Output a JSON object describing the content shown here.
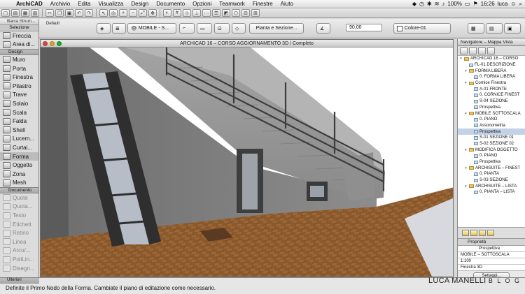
{
  "menubar": {
    "app": "ArchiCAD",
    "items": [
      "Archivio",
      "Edita",
      "Visualizza",
      "Design",
      "Documento",
      "Opzioni",
      "Teamwork",
      "Finestre",
      "Aiuto"
    ],
    "battery": "100%",
    "time": "16:26",
    "user": "luca"
  },
  "infobox": {
    "default_label": "Default",
    "layer": "MOBILE - S...",
    "view": "Pianta e Sezione...",
    "angle": "90,00",
    "color": "Colore-01"
  },
  "toolbox": {
    "header": "Barra Strum...",
    "selection": "Selezione",
    "select_tools": [
      {
        "icon": "arrow-icon",
        "label": "Freccia"
      },
      {
        "icon": "marquee-icon",
        "label": "Area di..."
      }
    ],
    "design_group": "Design",
    "design_tools": [
      {
        "icon": "wall-icon",
        "label": "Muro"
      },
      {
        "icon": "door-icon",
        "label": "Porta"
      },
      {
        "icon": "window-icon",
        "label": "Finestra"
      },
      {
        "icon": "column-icon",
        "label": "Pilastro"
      },
      {
        "icon": "beam-icon",
        "label": "Trave"
      },
      {
        "icon": "slab-icon",
        "label": "Solaio"
      },
      {
        "icon": "stair-icon",
        "label": "Scala"
      },
      {
        "icon": "roof-icon",
        "label": "Falda"
      },
      {
        "icon": "shell-icon",
        "label": "Shell"
      },
      {
        "icon": "skylight-icon",
        "label": "Lucern..."
      },
      {
        "icon": "curtain-wall-icon",
        "label": "Curtai..."
      },
      {
        "icon": "morph-icon",
        "label": "Forma"
      },
      {
        "icon": "object-icon",
        "label": "Oggetto"
      },
      {
        "icon": "zone-icon",
        "label": "Zona"
      },
      {
        "icon": "mesh-icon",
        "label": "Mesh"
      }
    ],
    "document_group": "Documento",
    "document_tools": [
      {
        "icon": "dimension-icon",
        "label": "Quote"
      },
      {
        "icon": "level-dimension-icon",
        "label": "Quota..."
      },
      {
        "icon": "text-icon",
        "label": "Testo"
      },
      {
        "icon": "label-icon",
        "label": "Etichett"
      },
      {
        "icon": "fill-icon",
        "label": "Retino"
      },
      {
        "icon": "line-icon",
        "label": "Linea"
      },
      {
        "icon": "arc-icon",
        "label": "Arco/..."
      },
      {
        "icon": "polyline-icon",
        "label": "PoliLin..."
      },
      {
        "icon": "drawing-icon",
        "label": "Disegn..."
      }
    ],
    "more_group": "Ulteriori"
  },
  "window": {
    "title": "ARCHICAD 16 – CORSO AGGIORNAMENTO 3D / Completo"
  },
  "navigator": {
    "header": "Navigatore – Mappa Vista",
    "tree": [
      {
        "level": 0,
        "type": "project",
        "label": "ARCHICAD 16 – CORSO",
        "selected": false
      },
      {
        "level": 1,
        "type": "plan",
        "label": "FL-01 DESCRIZIONE",
        "selected": false
      },
      {
        "level": 1,
        "type": "folder",
        "label": "FORMA LIBERA",
        "selected": false
      },
      {
        "level": 2,
        "type": "plan",
        "label": "0. FORMA LIBERA",
        "selected": false
      },
      {
        "level": 1,
        "type": "folder",
        "label": "Cornice Finestra",
        "selected": false
      },
      {
        "level": 2,
        "type": "plan",
        "label": "A-01 FRONTE",
        "selected": false
      },
      {
        "level": 2,
        "type": "plan",
        "label": "0. CORNICE FINEST",
        "selected": false
      },
      {
        "level": 2,
        "type": "plan",
        "label": "S-04 SEZIONE",
        "selected": false
      },
      {
        "level": 2,
        "type": "plan",
        "label": "Prospettiva",
        "selected": false
      },
      {
        "level": 1,
        "type": "folder",
        "label": "MOBILE SOTTOSCALA",
        "selected": false
      },
      {
        "level": 2,
        "type": "plan",
        "label": "0. PIANO",
        "selected": false
      },
      {
        "level": 2,
        "type": "plan",
        "label": "Assonometria",
        "selected": false
      },
      {
        "level": 2,
        "type": "plan",
        "label": "Prospettiva",
        "selected": true
      },
      {
        "level": 2,
        "type": "plan",
        "label": "S-01 SEZIONE 01",
        "selected": false
      },
      {
        "level": 2,
        "type": "plan",
        "label": "S-02 SEZIONE 02",
        "selected": false
      },
      {
        "level": 1,
        "type": "folder",
        "label": "MODIFICA OGGETTO",
        "selected": false
      },
      {
        "level": 2,
        "type": "plan",
        "label": "0. PIANO",
        "selected": false
      },
      {
        "level": 2,
        "type": "plan",
        "label": "Prospettiva",
        "selected": false
      },
      {
        "level": 1,
        "type": "folder",
        "label": "ARCHISUITE – FINEST",
        "selected": false
      },
      {
        "level": 2,
        "type": "plan",
        "label": "0. PIANTA",
        "selected": false
      },
      {
        "level": 2,
        "type": "plan",
        "label": "S-03 SEZIONE",
        "selected": false
      },
      {
        "level": 1,
        "type": "folder",
        "label": "ARCHISUITE – LISTA",
        "selected": false
      },
      {
        "level": 2,
        "type": "plan",
        "label": "0. PIANTA – LISTA",
        "selected": false
      }
    ],
    "properties_header": "Proprietà",
    "properties": {
      "name": "Prospettiva",
      "layer_combo": "MOBILE – SOTTOSCALA",
      "scale": "1:100",
      "structure": "Finestra 3D"
    },
    "settings_label": "Settaggi..."
  },
  "status": {
    "message": "Definite il Primo Nodo della Forma. Cambiate il piano di editazione come necessario."
  },
  "watermark": {
    "name": "LUCA MANELLI",
    "sub": "B L O G"
  },
  "colors": {
    "floor": "#8a5a2e",
    "wall": "#7d7d7d",
    "stair": "#9a9a9a",
    "rail": "#3c3c3c"
  }
}
